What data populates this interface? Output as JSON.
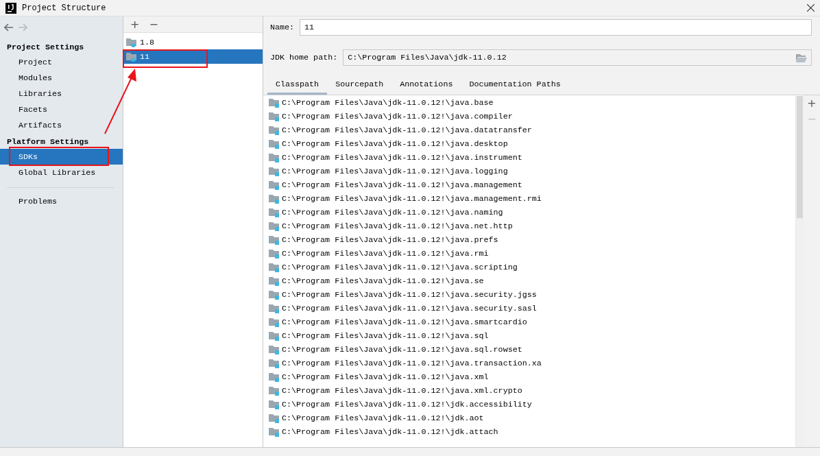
{
  "window": {
    "title": "Project Structure"
  },
  "nav": {
    "back_disabled": false,
    "forward_disabled": true
  },
  "sidebar": {
    "sections": [
      {
        "title": "Project Settings",
        "items": [
          {
            "label": "Project",
            "selected": false
          },
          {
            "label": "Modules",
            "selected": false
          },
          {
            "label": "Libraries",
            "selected": false
          },
          {
            "label": "Facets",
            "selected": false
          },
          {
            "label": "Artifacts",
            "selected": false
          }
        ]
      },
      {
        "title": "Platform Settings",
        "items": [
          {
            "label": "SDKs",
            "selected": true
          },
          {
            "label": "Global Libraries",
            "selected": false
          }
        ]
      }
    ],
    "footer_items": [
      {
        "label": "Problems",
        "selected": false
      }
    ]
  },
  "sdk_list": {
    "toolbar": [
      "+",
      "−"
    ],
    "items": [
      {
        "label": "1.8",
        "selected": false
      },
      {
        "label": "11",
        "selected": true
      }
    ]
  },
  "details": {
    "name_label": "Name:",
    "name_value": "11",
    "home_label": "JDK home path:",
    "home_value": "C:\\Program Files\\Java\\jdk-11.0.12",
    "tabs": [
      {
        "label": "Classpath",
        "selected": true
      },
      {
        "label": "Sourcepath",
        "selected": false
      },
      {
        "label": "Annotations",
        "selected": false
      },
      {
        "label": "Documentation Paths",
        "selected": false
      }
    ],
    "side_buttons": [
      {
        "label": "+",
        "disabled": false
      },
      {
        "label": "−",
        "disabled": true
      }
    ],
    "classpath": [
      "C:\\Program Files\\Java\\jdk-11.0.12!\\java.base",
      "C:\\Program Files\\Java\\jdk-11.0.12!\\java.compiler",
      "C:\\Program Files\\Java\\jdk-11.0.12!\\java.datatransfer",
      "C:\\Program Files\\Java\\jdk-11.0.12!\\java.desktop",
      "C:\\Program Files\\Java\\jdk-11.0.12!\\java.instrument",
      "C:\\Program Files\\Java\\jdk-11.0.12!\\java.logging",
      "C:\\Program Files\\Java\\jdk-11.0.12!\\java.management",
      "C:\\Program Files\\Java\\jdk-11.0.12!\\java.management.rmi",
      "C:\\Program Files\\Java\\jdk-11.0.12!\\java.naming",
      "C:\\Program Files\\Java\\jdk-11.0.12!\\java.net.http",
      "C:\\Program Files\\Java\\jdk-11.0.12!\\java.prefs",
      "C:\\Program Files\\Java\\jdk-11.0.12!\\java.rmi",
      "C:\\Program Files\\Java\\jdk-11.0.12!\\java.scripting",
      "C:\\Program Files\\Java\\jdk-11.0.12!\\java.se",
      "C:\\Program Files\\Java\\jdk-11.0.12!\\java.security.jgss",
      "C:\\Program Files\\Java\\jdk-11.0.12!\\java.security.sasl",
      "C:\\Program Files\\Java\\jdk-11.0.12!\\java.smartcardio",
      "C:\\Program Files\\Java\\jdk-11.0.12!\\java.sql",
      "C:\\Program Files\\Java\\jdk-11.0.12!\\java.sql.rowset",
      "C:\\Program Files\\Java\\jdk-11.0.12!\\java.transaction.xa",
      "C:\\Program Files\\Java\\jdk-11.0.12!\\java.xml",
      "C:\\Program Files\\Java\\jdk-11.0.12!\\java.xml.crypto",
      "C:\\Program Files\\Java\\jdk-11.0.12!\\jdk.accessibility",
      "C:\\Program Files\\Java\\jdk-11.0.12!\\jdk.aot",
      "C:\\Program Files\\Java\\jdk-11.0.12!\\jdk.attach"
    ]
  }
}
